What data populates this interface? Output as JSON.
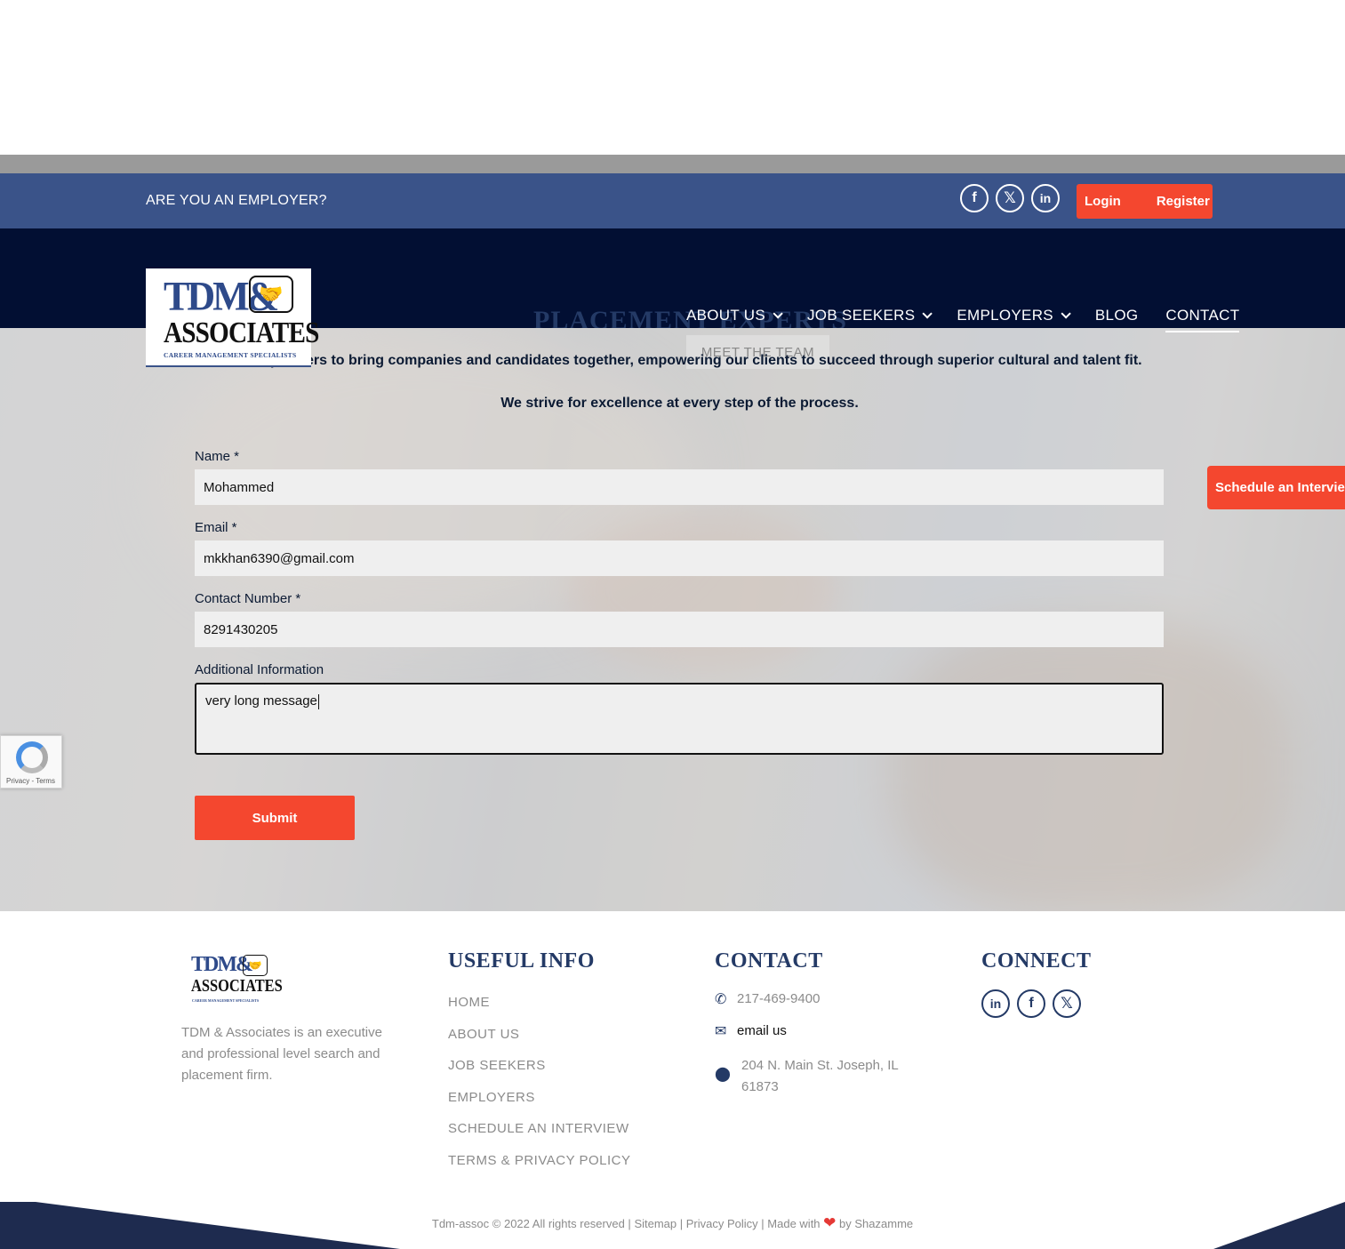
{
  "utility_bar": {
    "employer_text": "ARE YOU AN EMPLOYER?",
    "social": [
      "facebook-icon",
      "x-icon",
      "linkedin-icon"
    ],
    "login_label": "Login",
    "register_label": "Register"
  },
  "logo": {
    "line1": "TDM&",
    "line2": "ASSOCIATES",
    "tagline": "CAREER MANAGEMENT SPECIALISTS"
  },
  "nav": {
    "items": [
      {
        "label": "ABOUT US",
        "has_dropdown": true
      },
      {
        "label": "JOB SEEKERS",
        "has_dropdown": true
      },
      {
        "label": "EMPLOYERS",
        "has_dropdown": true
      },
      {
        "label": "BLOG",
        "has_dropdown": false
      },
      {
        "label": "CONTACT",
        "has_dropdown": false,
        "active": true
      }
    ]
  },
  "hero": {
    "meet_team_label": "MEET THE TEAM",
    "heading_peek": "PLACEMENT EXPERTS",
    "intro_line1": "ociates partners to bring companies and candidates together, empowering our clients to succeed through superior cultural and talent fit.",
    "intro_line2": "We strive for excellence at every step of the process."
  },
  "form": {
    "name_label": "Name *",
    "name_value": "Mohammed",
    "email_label": "Email *",
    "email_value": "mkkhan6390@gmail.com",
    "phone_label": "Contact Number *",
    "phone_value": "8291430205",
    "info_label": "Additional Information",
    "info_value": "very long message",
    "submit_label": "Submit"
  },
  "schedule_tab_label": "Schedule an Interview",
  "recaptcha": {
    "text": "Privacy - Terms"
  },
  "footer": {
    "about_text": "TDM & Associates is an executive and professional level search and placement firm.",
    "useful_heading": "USEFUL INFO",
    "useful_links": [
      "HOME",
      "ABOUT US",
      "JOB SEEKERS",
      "EMPLOYERS",
      "SCHEDULE AN INTERVIEW",
      "TERMS & PRIVACY POLICY"
    ],
    "contact_heading": "CONTACT",
    "phone": "217-469-9400",
    "email_link": "email us",
    "address": "204 N. Main St. Joseph, IL 61873",
    "connect_heading": "CONNECT",
    "connect_icons": [
      "linkedin-icon",
      "facebook-icon",
      "x-icon"
    ]
  },
  "copyright": {
    "text": "Tdm-assoc © 2022 All rights reserved |",
    "sitemap": "Sitemap",
    "privacy": "Privacy Policy",
    "made_with": "Made with",
    "by": "by Shazamme"
  },
  "colors": {
    "utility_bar": "#3a5389",
    "nav_bar": "#020f33",
    "accent": "#f4472f",
    "heading_blue": "#243a66",
    "footer_band": "#1e2b4f"
  }
}
